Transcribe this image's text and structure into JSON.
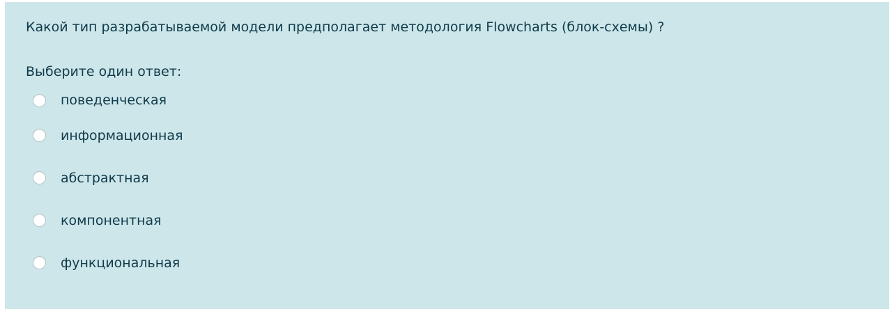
{
  "question": {
    "text": "Какой тип разрабатываемой модели предполагает методология Flowcharts (блок-схемы) ?",
    "prompt": "Выберите один ответ:",
    "options": [
      {
        "label": "поведенческая",
        "selected": false
      },
      {
        "label": "информационная",
        "selected": false
      },
      {
        "label": "абстрактная",
        "selected": false
      },
      {
        "label": "компонентная",
        "selected": false
      },
      {
        "label": "функциональная",
        "selected": false
      }
    ]
  },
  "colors": {
    "panel_background": "#cde6ea",
    "text": "#0f3b4a",
    "radio_fill": "#ffffff",
    "radio_border": "#b8c4c7"
  }
}
